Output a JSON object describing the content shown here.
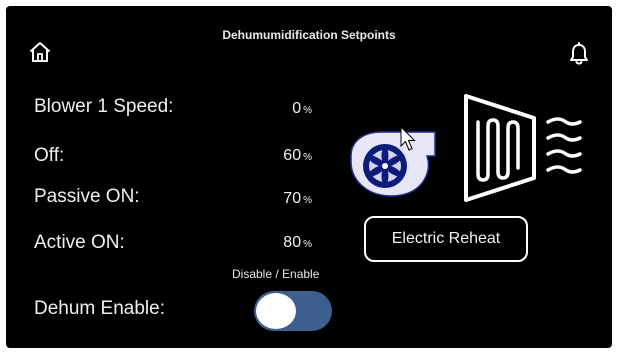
{
  "header": {
    "title": "Dehumumidification Setpoints",
    "home_icon": "home-icon",
    "bell_icon": "bell-icon"
  },
  "setpoints": [
    {
      "label": "Blower 1 Speed:",
      "value": "0",
      "unit": "%"
    },
    {
      "label": "Off:",
      "value": "60",
      "unit": "%"
    },
    {
      "label": "Passive ON:",
      "value": "70",
      "unit": "%"
    },
    {
      "label": "Active ON:",
      "value": "80",
      "unit": "%"
    }
  ],
  "dehum": {
    "toggle_caption": "Disable / Enable",
    "label": "Dehum Enable:",
    "enabled": false
  },
  "equipment": {
    "blower_icon": "blower-fan-icon",
    "heater_icon": "electric-heater-icon",
    "reheat_label": "Electric Reheat"
  },
  "colors": {
    "background": "#000000",
    "toggle_track": "#3d5f8e",
    "blower_housing": "#e6e6f6"
  }
}
